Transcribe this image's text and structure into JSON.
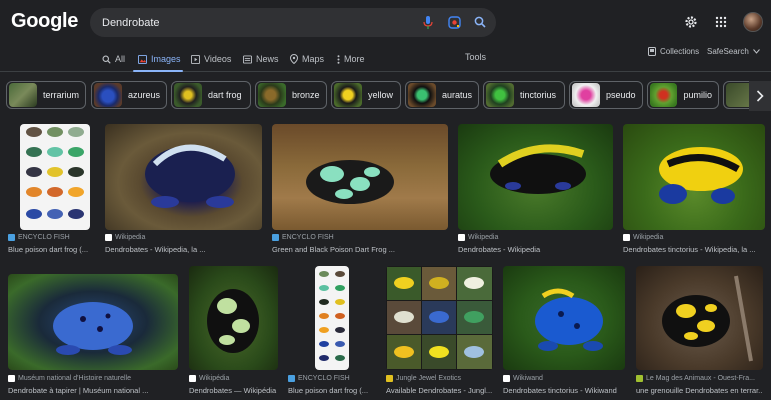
{
  "header": {
    "logo_text": "Google",
    "search_query": "Dendrobate"
  },
  "tabs": {
    "items": [
      {
        "label": "All"
      },
      {
        "label": "Images"
      },
      {
        "label": "Videos"
      },
      {
        "label": "News"
      },
      {
        "label": "Maps"
      },
      {
        "label": "More"
      }
    ],
    "tools_label": "Tools",
    "collections_label": "Collections",
    "safesearch_label": "SafeSearch"
  },
  "chips": [
    {
      "label": "terrarium"
    },
    {
      "label": "azureus"
    },
    {
      "label": "dart frog"
    },
    {
      "label": "bronze"
    },
    {
      "label": "yellow"
    },
    {
      "label": "auratus"
    },
    {
      "label": "tinctorius"
    },
    {
      "label": "pseudo"
    },
    {
      "label": "pumilio"
    }
  ],
  "results": [
    {
      "source": "ENCYCLO FISH",
      "title": "Blue poison dart frog (..."
    },
    {
      "source": "Wikipedia",
      "title": "Dendrobates - Wikipedia, la ..."
    },
    {
      "source": "ENCYCLO FISH",
      "title": "Green and Black Poison Dart Frog ..."
    },
    {
      "source": "Wikipedia",
      "title": "Dendrobates - Wikipedia"
    },
    {
      "source": "Wikipedia",
      "title": "Dendrobates tinctorius - Wikipedia, la ..."
    },
    {
      "source": "Muséum national d'Histoire naturelle",
      "title": "Dendrobate à tapirer | Muséum national ..."
    },
    {
      "source": "Wikipédia",
      "title": "Dendrobates — Wikipédia"
    },
    {
      "source": "ENCYCLO FISH",
      "title": "Blue poison dart frog (..."
    },
    {
      "source": "Jungle Jewel Exotics",
      "title": "Available Dendrobates - Jungl..."
    },
    {
      "source": "Wikiwand",
      "title": "Dendrobates tinctorius - Wikiwand"
    },
    {
      "source": "Le Mag des Animaux - Ouest-Fra...",
      "title": "une grenouille Dendrobates en terrar..."
    }
  ],
  "colors": {
    "background": "#202124",
    "accent": "#8ab4f8"
  }
}
